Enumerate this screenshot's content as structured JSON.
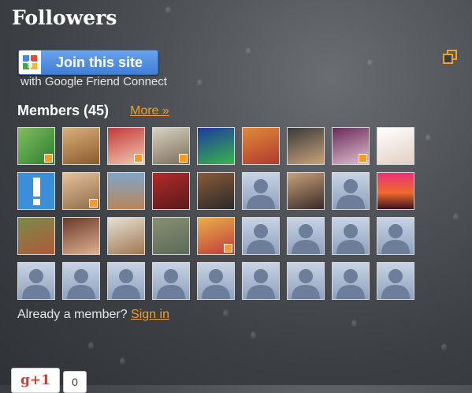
{
  "widget": {
    "title": "Followers",
    "join_button_label": "Join this site",
    "join_subtext": "with Google Friend Connect",
    "members_label": "Members (45)",
    "more_link": "More »",
    "already_text": "Already a member?",
    "sign_in_link": "Sign in"
  },
  "gplus": {
    "label": "g+1",
    "count": "0"
  },
  "colors": {
    "link": "#f0a030",
    "join_button": "#4a89dc"
  }
}
